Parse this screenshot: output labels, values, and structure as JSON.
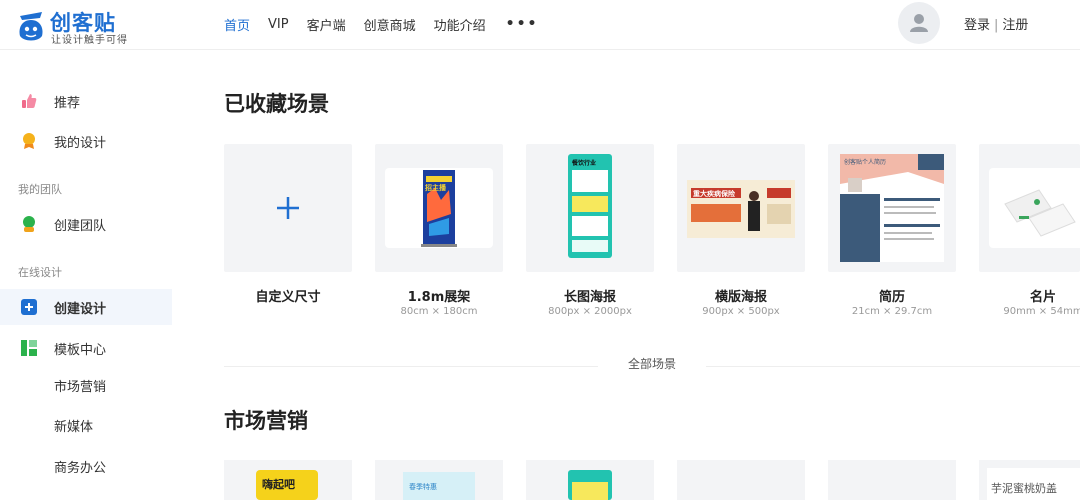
{
  "logo": {
    "name": "创客贴",
    "slogan": "让设计触手可得"
  },
  "nav": {
    "items": [
      {
        "label": "首页",
        "active": true
      },
      {
        "label": "VIP",
        "active": false
      },
      {
        "label": "客户端",
        "active": false
      },
      {
        "label": "创意商城",
        "active": false
      },
      {
        "label": "功能介绍",
        "active": false
      }
    ],
    "more": "•••"
  },
  "auth": {
    "login": "登录",
    "separator": "|",
    "register": "注册"
  },
  "sidebar": {
    "recommend": "推荐",
    "my_design": "我的设计",
    "team_group": "我的团队",
    "create_team": "创建团队",
    "online_group": "在线设计",
    "create_design": "创建设计",
    "template_center": "模板中心",
    "sub_items": [
      "市场营销",
      "新媒体",
      "商务办公"
    ]
  },
  "collected": {
    "title": "已收藏场景",
    "cards": [
      {
        "name": "自定义尺寸",
        "size": ""
      },
      {
        "name": "1.8m展架",
        "size": "80cm × 180cm"
      },
      {
        "name": "长图海报",
        "size": "800px × 2000px"
      },
      {
        "name": "横版海报",
        "size": "900px × 500px"
      },
      {
        "name": "简历",
        "size": "21cm × 29.7cm"
      },
      {
        "name": "名片",
        "size": "90mm × 54mm"
      }
    ],
    "all_scenes": "全部场景"
  },
  "marketing": {
    "title": "市场营销"
  },
  "thumb_text": {
    "banner": "招主播",
    "poster_head": "餐饮行业",
    "hposter_head": "重大疾病保险",
    "resume_head": "创客贴个人简历",
    "m1": "嗨起吧",
    "m2": "春季特惠",
    "m6": "芋泥蜜桃奶盖"
  },
  "colors": {
    "accent": "#1f6fd1",
    "active_bg": "#f2f6fc"
  }
}
